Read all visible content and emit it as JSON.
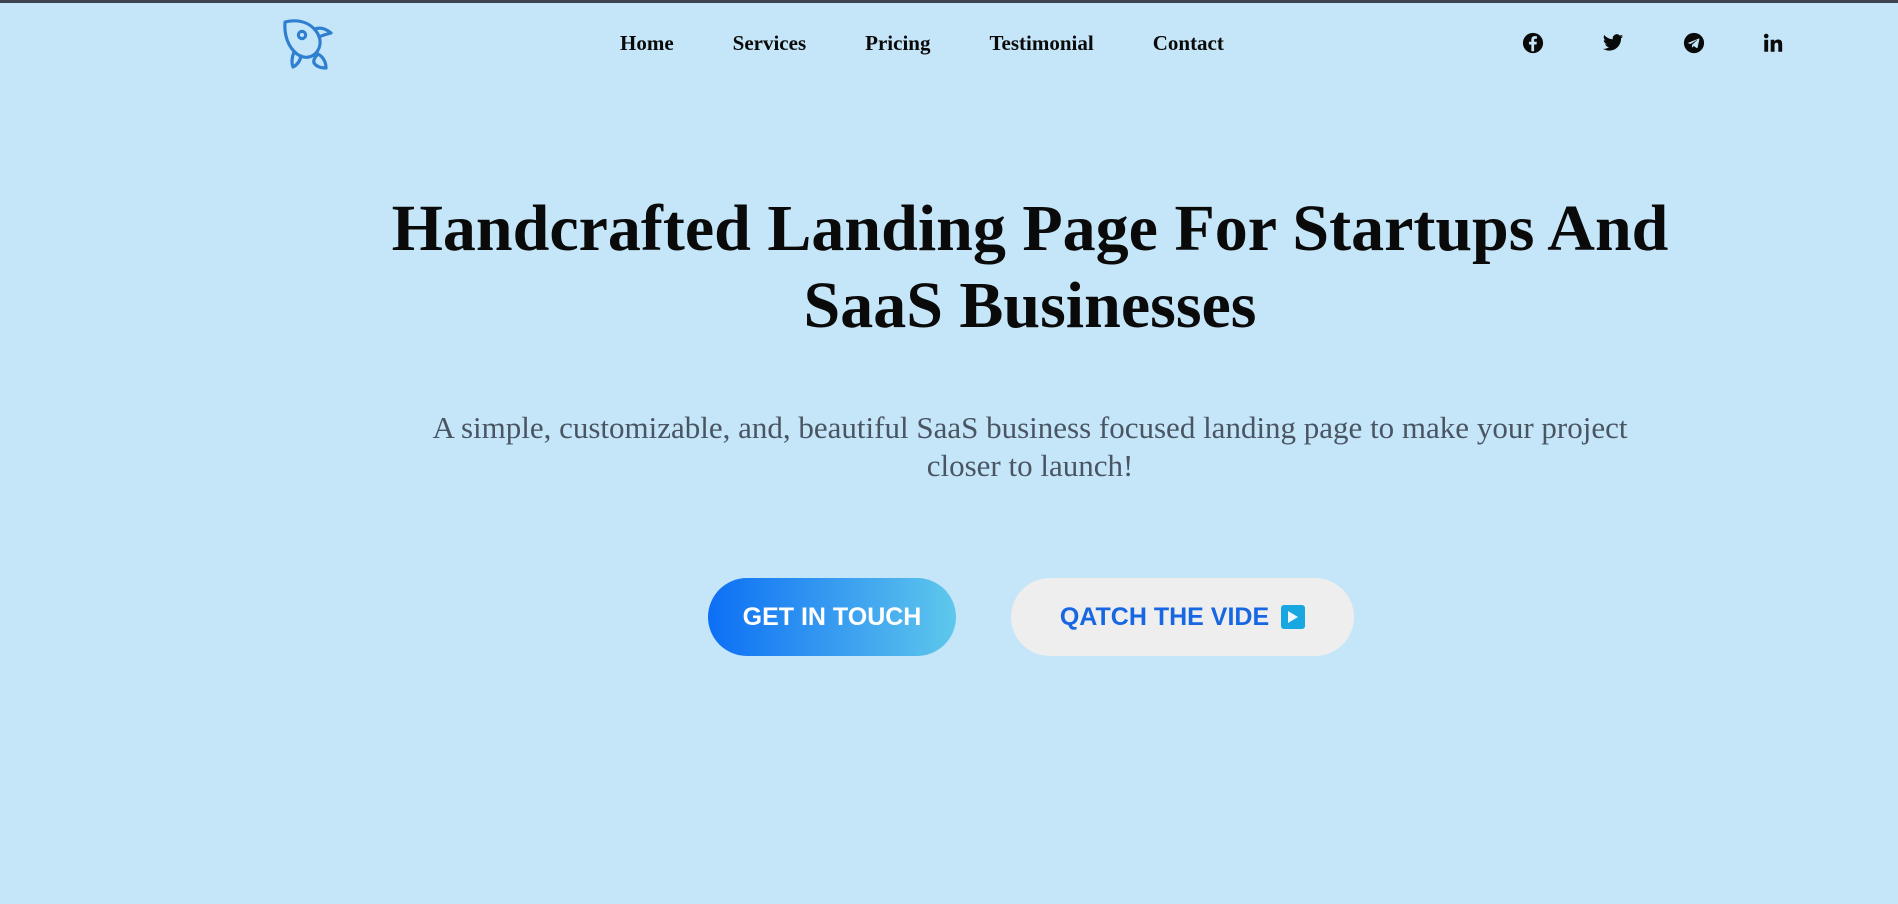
{
  "header": {
    "logo_icon": "rocket-icon",
    "accent_color": "#2f7fd0",
    "nav": [
      {
        "label": "Home"
      },
      {
        "label": "Services"
      },
      {
        "label": "Pricing"
      },
      {
        "label": "Testimonial"
      },
      {
        "label": "Contact"
      }
    ],
    "social": [
      {
        "icon": "facebook-icon"
      },
      {
        "icon": "twitter-icon"
      },
      {
        "icon": "telegram-icon"
      },
      {
        "icon": "linkedin-icon"
      }
    ]
  },
  "hero": {
    "title_line1": "Handcrafted Landing Page For Startups And",
    "title_line2": "SaaS Businesses",
    "subtitle_line1": "A simple, customizable, and, beautiful SaaS business focused landing page to make your project",
    "subtitle_line2": "closer to launch!",
    "primary_button": "GET IN TOUCH",
    "secondary_button": "QATCH THE VIDE",
    "secondary_button_icon": "play-icon"
  },
  "colors": {
    "background": "#c5e6f8",
    "heading": "#0a0a0a",
    "subtitle": "#4a5563",
    "button_gradient_start": "#0c6ff5",
    "button_gradient_end": "#5ec8ec",
    "secondary_text": "#1767e3",
    "secondary_bg": "#eeeeee"
  }
}
